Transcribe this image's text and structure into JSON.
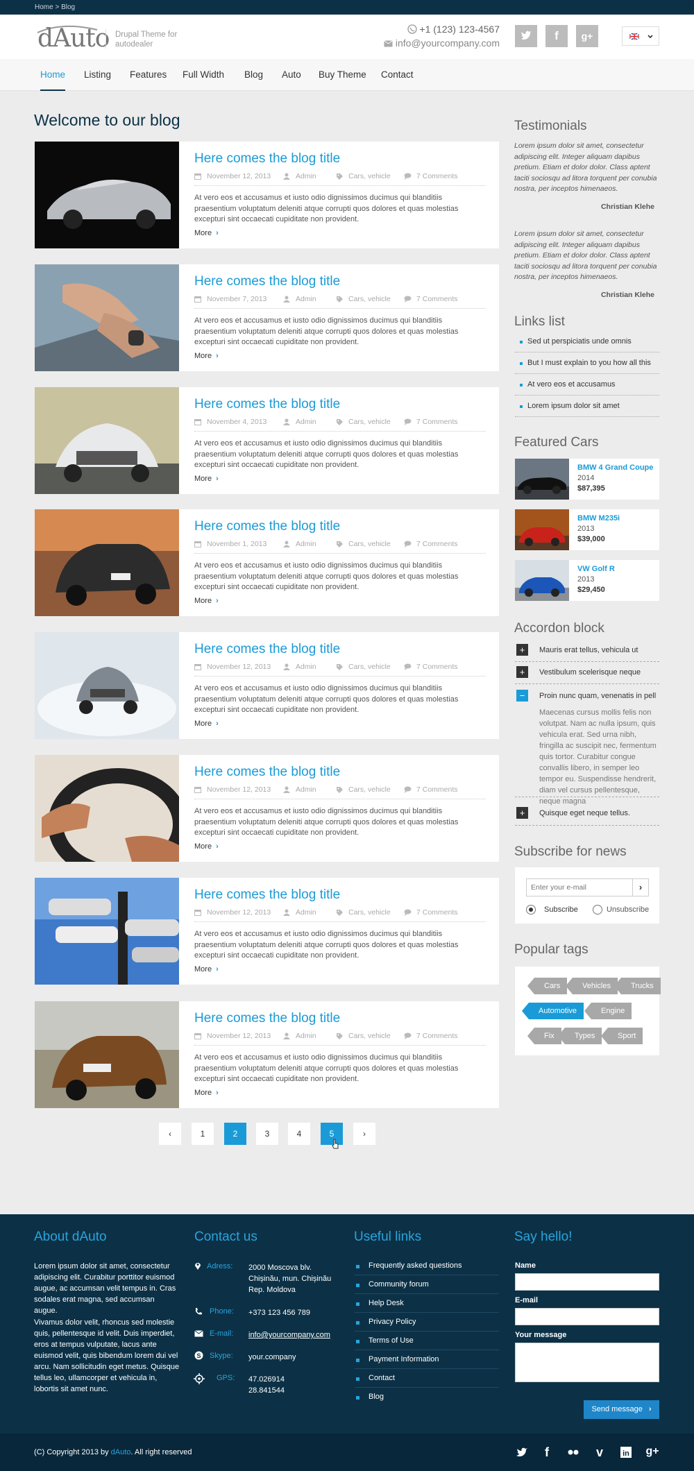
{
  "breadcrumb": "Home > Blog",
  "header": {
    "logo": "dAuto",
    "tagline": "Drupal Theme for autodealer",
    "phone": "+1 (123) 123-4567",
    "email": "info@yourcompany.com",
    "social": [
      "twitter-icon",
      "facebook-icon",
      "google-plus-icon"
    ]
  },
  "nav": {
    "items": [
      "Home",
      "Listing",
      "Features",
      "Full Width",
      "Blog",
      "Auto",
      "Buy Theme",
      "Contact"
    ],
    "active": "Home"
  },
  "main": {
    "heading": "Welcome to our blog",
    "posts": [
      {
        "title": "Here comes the blog title",
        "date": "November 12, 2013",
        "author": "Admin",
        "tags": "Cars, vehicle",
        "comments": "7 Comments",
        "excerpt": "At vero eos et accusamus et iusto odio dignissimos ducimus qui blanditiis praesentium voluptatum deleniti atque corrupti quos dolores et quas molestias excepturi sint occaecati cupiditate non provident.",
        "more": "More"
      },
      {
        "title": "Here comes the blog title",
        "date": "November 7, 2013",
        "author": "Admin",
        "tags": "Cars, vehicle",
        "comments": "7 Comments",
        "excerpt": "At vero eos et accusamus et iusto odio dignissimos ducimus qui blanditiis praesentium voluptatum deleniti atque corrupti quos dolores et quas molestias excepturi sint occaecati cupiditate non provident.",
        "more": "More"
      },
      {
        "title": "Here comes the blog title",
        "date": "November 4, 2013",
        "author": "Admin",
        "tags": "Cars, vehicle",
        "comments": "7 Comments",
        "excerpt": "At vero eos et accusamus et iusto odio dignissimos ducimus qui blanditiis praesentium voluptatum deleniti atque corrupti quos dolores et quas molestias excepturi sint occaecati cupiditate non provident.",
        "more": "More"
      },
      {
        "title": "Here comes the blog title",
        "date": "November 1, 2013",
        "author": "Admin",
        "tags": "Cars, vehicle",
        "comments": "7 Comments",
        "excerpt": "At vero eos et accusamus et iusto odio dignissimos ducimus qui blanditiis praesentium voluptatum deleniti atque corrupti quos dolores et quas molestias excepturi sint occaecati cupiditate non provident.",
        "more": "More"
      },
      {
        "title": "Here comes the blog title",
        "date": "November 12, 2013",
        "author": "Admin",
        "tags": "Cars, vehicle",
        "comments": "7 Comments",
        "excerpt": "At vero eos et accusamus et iusto odio dignissimos ducimus qui blanditiis praesentium voluptatum deleniti atque corrupti quos dolores et quas molestias excepturi sint occaecati cupiditate non provident.",
        "more": "More"
      },
      {
        "title": "Here comes the blog title",
        "date": "November 12, 2013",
        "author": "Admin",
        "tags": "Cars, vehicle",
        "comments": "7 Comments",
        "excerpt": "At vero eos et accusamus et iusto odio dignissimos ducimus qui blanditiis praesentium voluptatum deleniti atque corrupti quos dolores et quas molestias excepturi sint occaecati cupiditate non provident.",
        "more": "More"
      },
      {
        "title": "Here comes the blog title",
        "date": "November 12, 2013",
        "author": "Admin",
        "tags": "Cars, vehicle",
        "comments": "7 Comments",
        "excerpt": "At vero eos et accusamus et iusto odio dignissimos ducimus qui blanditiis praesentium voluptatum deleniti atque corrupti quos dolores et quas molestias excepturi sint occaecati cupiditate non provident.",
        "more": "More"
      },
      {
        "title": "Here comes the blog title",
        "date": "November 12, 2013",
        "author": "Admin",
        "tags": "Cars, vehicle",
        "comments": "7 Comments",
        "excerpt": "At vero eos et accusamus et iusto odio dignissimos ducimus qui blanditiis praesentium voluptatum deleniti atque corrupti quos dolores et quas molestias excepturi sint occaecati cupiditate non provident.",
        "more": "More"
      }
    ],
    "pagination": {
      "pages": [
        "1",
        "2",
        "3",
        "4",
        "5"
      ],
      "current": "2",
      "hovered": "5",
      "prev": "prev-icon",
      "next": "next-icon"
    }
  },
  "sidebar": {
    "testimonials": {
      "heading": "Testimonials",
      "items": [
        {
          "text": "Lorem ipsum dolor sit amet, consectetur adipiscing elit. Integer aliquam dapibus pretium. Etiam et dolor dolor. Class aptent taciti sociosqu ad litora torquent per conubia nostra, per inceptos himenaeos.",
          "author": "Christian Klehe"
        },
        {
          "text": "Lorem ipsum dolor sit amet, consectetur adipiscing elit. Integer aliquam dapibus pretium. Etiam et dolor dolor. Class aptent taciti sociosqu ad litora torquent per conubia nostra, per inceptos himenaeos.",
          "author": "Christian Klehe"
        }
      ]
    },
    "links": {
      "heading": "Links list",
      "items": [
        "Sed ut perspiciatis unde omnis",
        "But I must explain to you how all this",
        "At vero eos et accusamus",
        "Lorem ipsum dolor sit amet"
      ]
    },
    "featured": {
      "heading": "Featured Cars",
      "items": [
        {
          "name": "BMW 4 Grand Coupe",
          "year": "2014",
          "price": "$87,395"
        },
        {
          "name": "BMW M235i",
          "year": "2013",
          "price": "$39,000"
        },
        {
          "name": "VW Golf R",
          "year": "2013",
          "price": "$29,450"
        }
      ]
    },
    "accordion": {
      "heading": "Accordon block",
      "items": [
        "Mauris erat tellus, vehicula ut",
        "Vestibulum scelerisque neque",
        "Proin nunc quam, venenatis in pell",
        "Quisque eget neque tellus."
      ],
      "open_body": "Maecenas cursus mollis felis non volutpat. Nam ac nulla ipsum, quis vehicula erat. Sed urna nibh, fringilla ac suscipit nec, fermentum quis tortor. Curabitur congue convallis libero, in semper leo tempor eu. Suspendisse hendrerit, diam vel cursus pellentesque, neque magna"
    },
    "subscribe": {
      "heading": "Subscribe for news",
      "placeholder": "Enter your e-mail",
      "opt_subscribe": "Subscribe",
      "opt_unsubscribe": "Unsubscribe"
    },
    "tags": {
      "heading": "Popular tags",
      "items": [
        "Cars",
        "Vehicles",
        "Trucks",
        "Automotive",
        "Engine",
        "Fix",
        "Types",
        "Sport"
      ],
      "active": "Automotive"
    }
  },
  "footer": {
    "about": {
      "heading": "About dAuto",
      "p1": "Lorem ipsum dolor sit amet, consectetur adipiscing elit. Curabitur porttitor euismod augue, ac accumsan velit tempus in. Cras sodales erat magna, sed accumsan augue.",
      "p2": "Vivamus dolor velit, rhoncus sed molestie quis, pellentesque id velit. Duis imperdiet, eros at tempus vulputate, lacus ante euismod velit, quis bibendum lorem dui vel arcu. Nam sollicitudin eget metus. Quisque tellus leo, ullamcorper et vehicula in, lobortis sit amet nunc."
    },
    "contact": {
      "heading": "Contact us",
      "address_label": "Adress:",
      "address": "2000 Moscova blv. Chișinău, mun. Chișinău Rep. Moldova",
      "phone_label": "Phone:",
      "phone": "+373 123 456 789",
      "email_label": "E-mail:",
      "email": "info@yourcompany.com",
      "skype_label": "Skype:",
      "skype": "your.company",
      "gps_label": "GPS:",
      "gps_lat": "47.026914",
      "gps_lon": "28.841544"
    },
    "links": {
      "heading": "Useful links",
      "items": [
        "Frequently asked questions",
        "Community forum",
        "Help Desk",
        "Privacy Policy",
        "Terms of Use",
        "Payment Information",
        "Contact",
        "Blog"
      ]
    },
    "hello": {
      "heading": "Say hello!",
      "name_label": "Name",
      "email_label": "E-mail",
      "message_label": "Your message",
      "send": "Send message"
    },
    "copyright_pre": "(C) Copyright 2013 by ",
    "copyright_brand": "dAuto",
    "copyright_post": ". All right reserved",
    "social": [
      "twitter-icon",
      "facebook-icon",
      "flickr-icon",
      "vimeo-icon",
      "linkedin-icon",
      "google-plus-icon"
    ]
  },
  "colors": {
    "accent": "#1a9bd7",
    "navy": "#0c3146",
    "tag_gray": "#a8a8a8"
  }
}
